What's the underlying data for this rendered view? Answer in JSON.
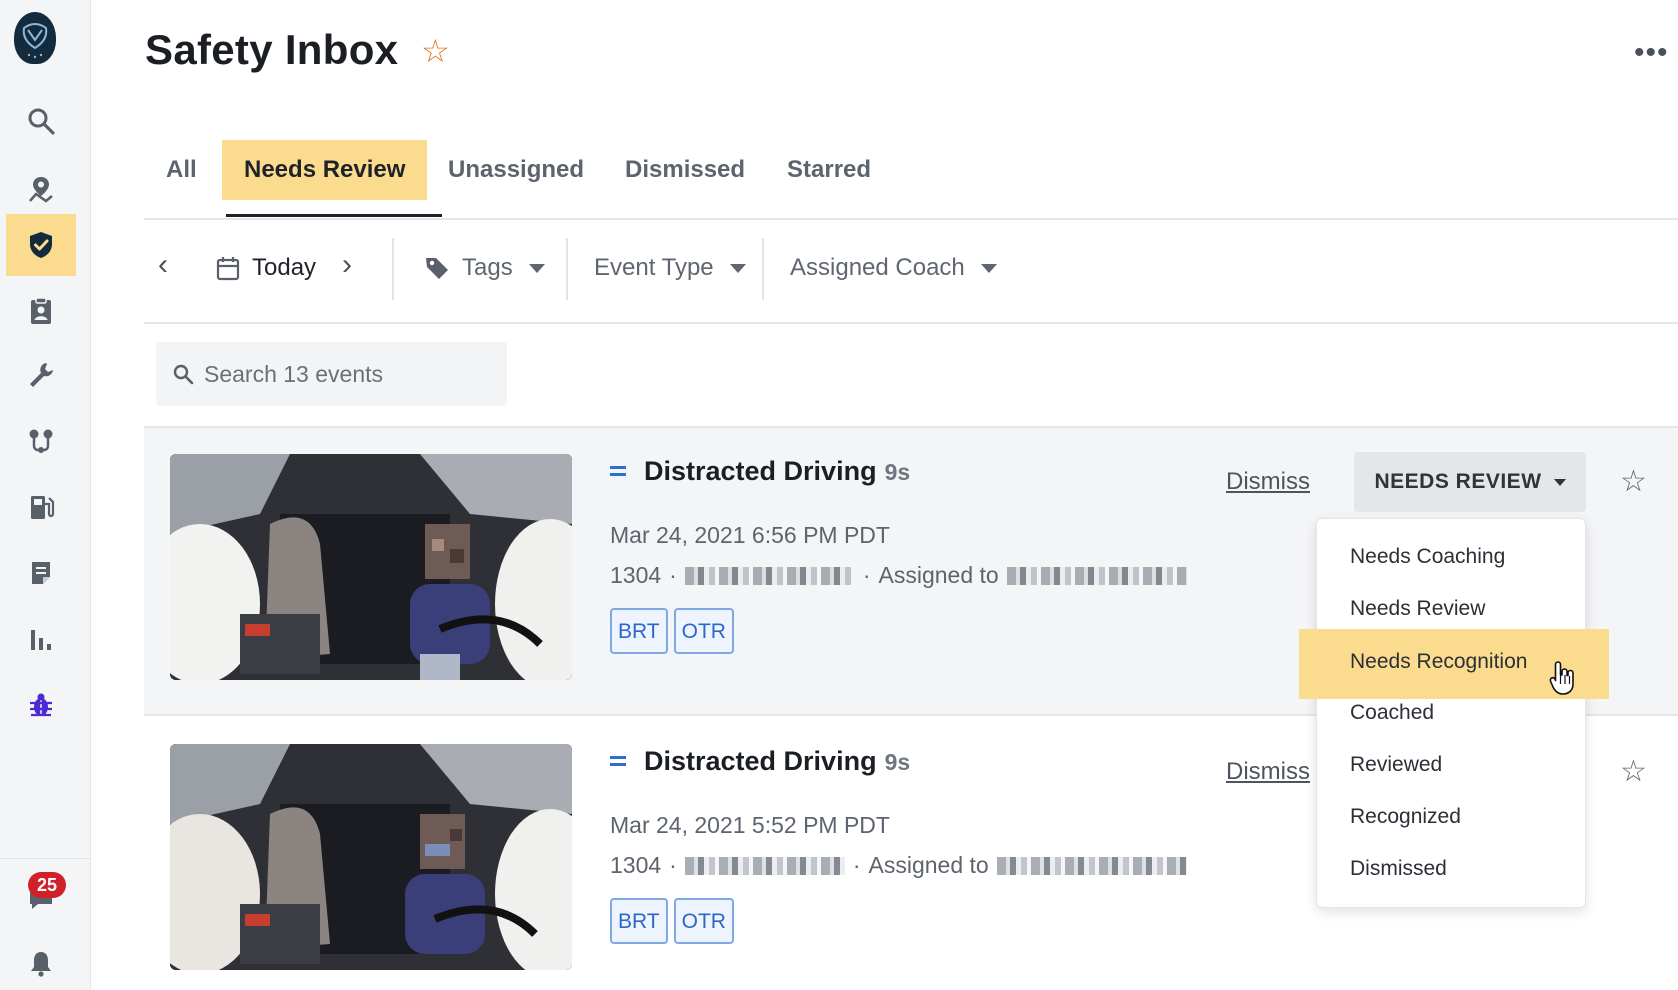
{
  "sidebar": {
    "logo": "owl-logo",
    "items": [
      {
        "name": "search",
        "icon": "search-icon",
        "active": false
      },
      {
        "name": "map",
        "icon": "map-pin-icon",
        "active": false
      },
      {
        "name": "safety",
        "icon": "shield-check-icon",
        "active": true
      },
      {
        "name": "drivers",
        "icon": "clipboard-user-icon",
        "active": false
      },
      {
        "name": "maintenance",
        "icon": "wrench-icon",
        "active": false
      },
      {
        "name": "routes",
        "icon": "route-icon",
        "active": false
      },
      {
        "name": "fuel",
        "icon": "fuel-icon",
        "active": false
      },
      {
        "name": "documents",
        "icon": "document-icon",
        "active": false
      },
      {
        "name": "reports",
        "icon": "bar-chart-icon",
        "active": false
      },
      {
        "name": "bug",
        "icon": "bug-icon",
        "active": false
      }
    ],
    "messages_badge": "25"
  },
  "header": {
    "title": "Safety Inbox",
    "more": "•••"
  },
  "tabs": [
    "All",
    "Needs Review",
    "Unassigned",
    "Dismissed",
    "Starred"
  ],
  "active_tab": "Needs Review",
  "filters": {
    "date": "Today",
    "tags": "Tags",
    "event_type": "Event Type",
    "assigned_coach": "Assigned Coach"
  },
  "search": {
    "placeholder": "Search 13 events"
  },
  "events": [
    {
      "title": "Distracted Driving",
      "duration": "9s",
      "datetime": "Mar 24, 2021 6:56 PM PDT",
      "vehicle": "1304",
      "sep": "·",
      "assigned_label": "Assigned to",
      "tags": [
        "BRT",
        "OTR"
      ],
      "dismiss": "Dismiss",
      "status": "NEEDS REVIEW"
    },
    {
      "title": "Distracted Driving",
      "duration": "9s",
      "datetime": "Mar 24, 2021 5:52 PM PDT",
      "vehicle": "1304",
      "sep": "·",
      "assigned_label": "Assigned to",
      "tags": [
        "BRT",
        "OTR"
      ],
      "dismiss": "Dismiss"
    }
  ],
  "status_menu": {
    "options": [
      "Needs Coaching",
      "Needs Review",
      "Needs Recognition",
      "Coached",
      "Reviewed",
      "Recognized",
      "Dismissed"
    ],
    "highlighted": "Needs Recognition"
  },
  "colors": {
    "accent": "#fbdc8f",
    "link_blue": "#2c6fd1",
    "badge_red": "#d0202a",
    "title_star": "#e0761a"
  }
}
